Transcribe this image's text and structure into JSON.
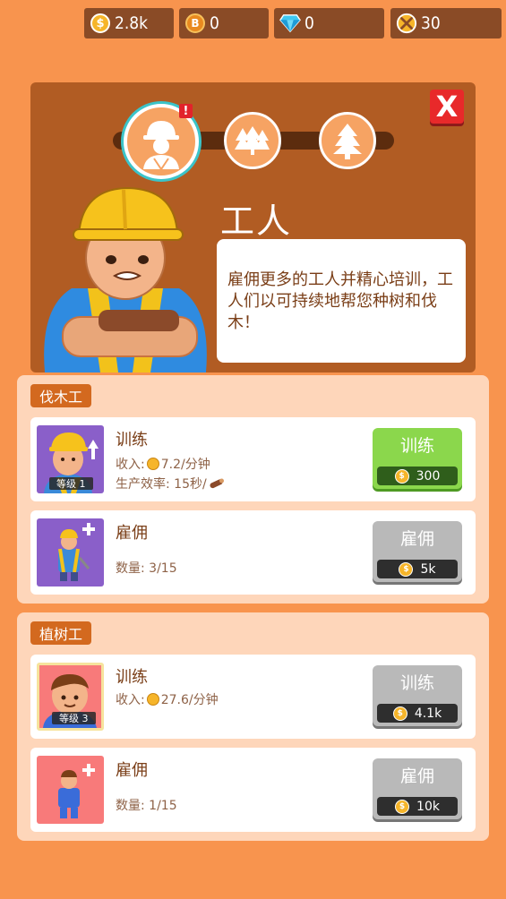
{
  "resources": {
    "coins": "2.8k",
    "bitcoin": "0",
    "diamonds": "0",
    "badge": "30"
  },
  "panel": {
    "title": "工人",
    "description": "雇佣更多的工人并精心培训，工人们以可持续地帮您种树和伐木！",
    "alert_mark": "!",
    "close_label": "X",
    "nodes": [
      "worker-icon",
      "small-trees-icon",
      "tree-icon"
    ]
  },
  "sections": [
    {
      "tag": "伐木工",
      "cards": [
        {
          "title": "训练",
          "line1_prefix": "收入:",
          "line1_value": "7.2/分钟",
          "line2": "生产效率: 15秒/",
          "level": "等级 1",
          "button_label": "训练",
          "button_price": "300",
          "button_state": "active"
        },
        {
          "title": "雇佣",
          "line1": "数量: 3/15",
          "button_label": "雇佣",
          "button_price": "5k",
          "button_state": "disabled"
        }
      ]
    },
    {
      "tag": "植树工",
      "cards": [
        {
          "title": "训练",
          "line1_prefix": "收入:",
          "line1_value": "27.6/分钟",
          "level": "等级 3",
          "button_label": "训练",
          "button_price": "4.1k",
          "button_state": "disabled"
        },
        {
          "title": "雇佣",
          "line1": "数量: 1/15",
          "button_label": "雇佣",
          "button_price": "10k",
          "button_state": "disabled"
        }
      ]
    }
  ],
  "colors": {
    "background": "#F8944E",
    "panel": "#B15C23",
    "section": "#FED6BA",
    "tag": "#D3691F",
    "button_active": "#8BD74C",
    "button_disabled": "#B9B9B9",
    "text_brown": "#7A3E17"
  }
}
